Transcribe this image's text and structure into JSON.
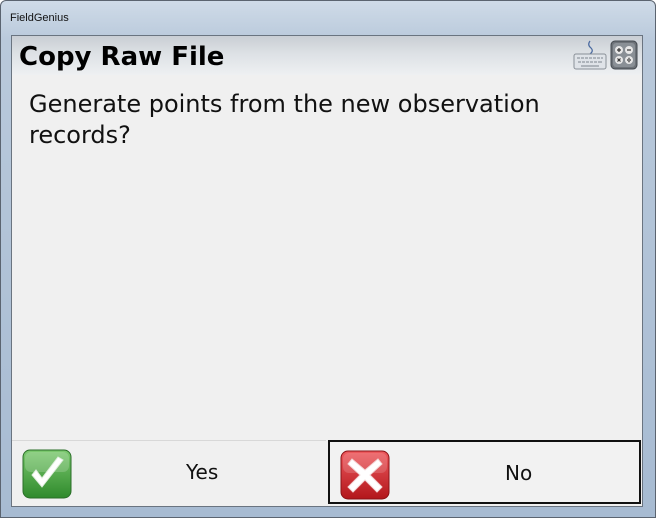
{
  "window": {
    "title": "FieldGenius"
  },
  "header": {
    "title": "Copy Raw File",
    "icons": {
      "keyboard": "keyboard-icon",
      "calculator": "calculator-icon"
    }
  },
  "message": {
    "text": "Generate points from the new observation records?"
  },
  "buttons": {
    "yes": {
      "label": "Yes",
      "icon": "checkmark-icon",
      "color": "#3ea33a"
    },
    "no": {
      "label": "No",
      "icon": "x-cross-icon",
      "color": "#d0252a"
    }
  }
}
